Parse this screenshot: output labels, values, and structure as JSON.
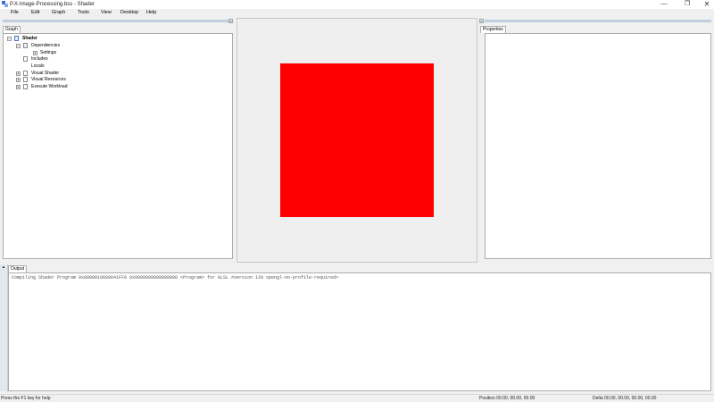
{
  "window": {
    "title": "P.X-Image-Processing.bss - Shader",
    "minimize_icon": "minimize-icon",
    "maximize_icon": "restore-icon",
    "close_icon": "close-icon",
    "min_glyph": "—",
    "max_glyph": "❐",
    "close_glyph": "✕"
  },
  "menu": [
    "File",
    "Edit",
    "Graph",
    "Tools",
    "View",
    "Desktop",
    "Help"
  ],
  "left_panel": {
    "tab": "Graph",
    "collapse_glyph": "«",
    "tree": [
      {
        "label": "Shader",
        "icon": "shader-icon",
        "expander": "−"
      },
      {
        "label": "Dependencies",
        "icon": "folder-icon",
        "expander": "−"
      },
      {
        "label": "Settings",
        "icon": "settings-icon",
        "expander": "+"
      },
      {
        "label": "Includes",
        "icon": "document-icon",
        "expander": ""
      },
      {
        "label": "Locals",
        "icon": "document-icon",
        "expander": ""
      },
      {
        "label": "Visual Shader",
        "icon": "document-icon",
        "expander": "+"
      },
      {
        "label": "Visual Resources",
        "icon": "document-icon",
        "expander": "+"
      },
      {
        "label": "Execute Workload",
        "icon": "document-icon",
        "expander": "+"
      }
    ]
  },
  "viewport": {
    "fill_color": "#ff0000",
    "background": "#efefef"
  },
  "right_panel": {
    "tab": "Properties",
    "collapse_glyph": "»"
  },
  "output_panel": {
    "tab": "Output",
    "pin_glyph": "▲",
    "text": "Compiling Shader Program 0x0000019680641FF0 0x0000000000000000 <Program> for GLSL  #version 120 opengl-no-profile-required>"
  },
  "status_bar": {
    "help": "Press the F1 key for help",
    "position": "Position 00.00, 00.00, 00.00",
    "delta": "Delta 00.00, 00.00, 00.00, 00.00"
  }
}
